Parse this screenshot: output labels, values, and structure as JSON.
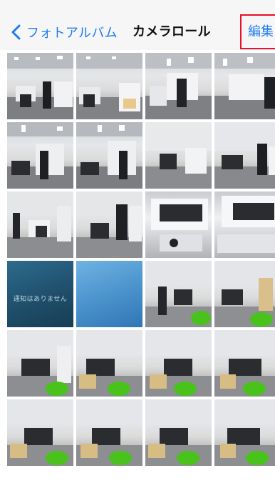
{
  "nav": {
    "back_label": "フォトアルバム",
    "title": "カメラロール",
    "edit_label": "編集"
  },
  "colors": {
    "accent": "#1f7cf2",
    "highlight_box": "#e8102a",
    "nav_background": "#f6f6f7"
  },
  "icons": {
    "back": "chevron-left-icon"
  },
  "grid": {
    "columns": 4,
    "lock_screen_tiles": [
      {
        "text": "通知はありません"
      },
      {
        "text": ""
      }
    ]
  }
}
